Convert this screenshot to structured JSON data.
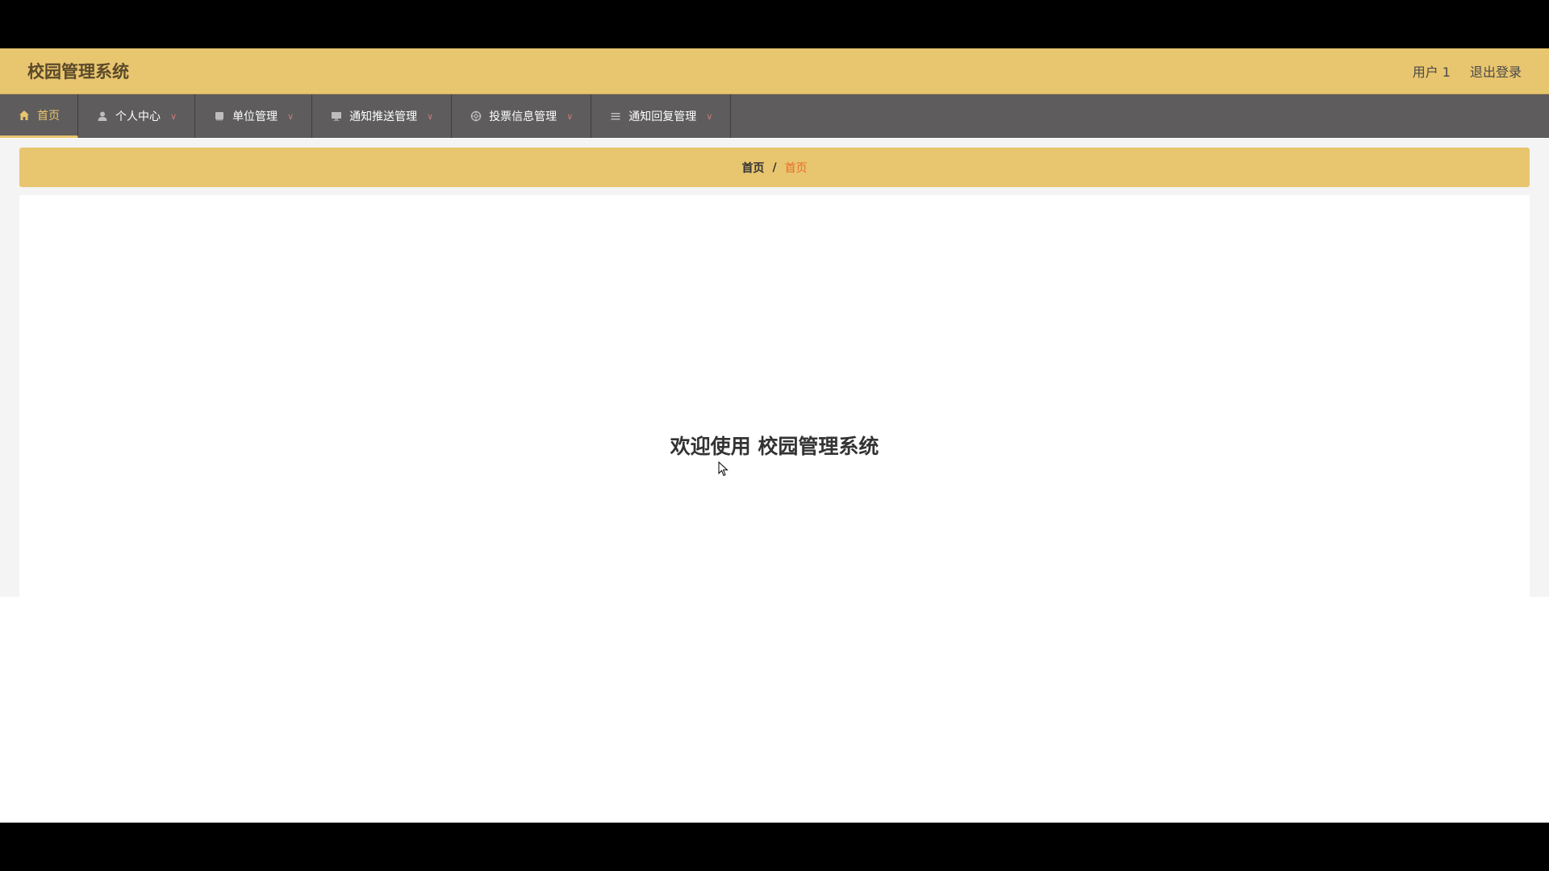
{
  "header": {
    "app_title": "校园管理系统",
    "user_label": "用户 1",
    "logout_label": "退出登录"
  },
  "nav": {
    "items": [
      {
        "label": "首页",
        "icon": "home-icon"
      },
      {
        "label": "个人中心",
        "icon": "user-icon"
      },
      {
        "label": "单位管理",
        "icon": "book-icon"
      },
      {
        "label": "通知推送管理",
        "icon": "monitor-icon"
      },
      {
        "label": "投票信息管理",
        "icon": "target-icon"
      },
      {
        "label": "通知回复管理",
        "icon": "list-icon"
      }
    ]
  },
  "breadcrumb": {
    "home": "首页",
    "separator": "/",
    "current": "首页"
  },
  "main": {
    "welcome_text": "欢迎使用 校园管理系统"
  },
  "colors": {
    "header_bg": "#e8c56f",
    "nav_bg": "#5e5c5c",
    "active_accent": "#e8c56f",
    "breadcrumb_current": "#e96d2b"
  }
}
